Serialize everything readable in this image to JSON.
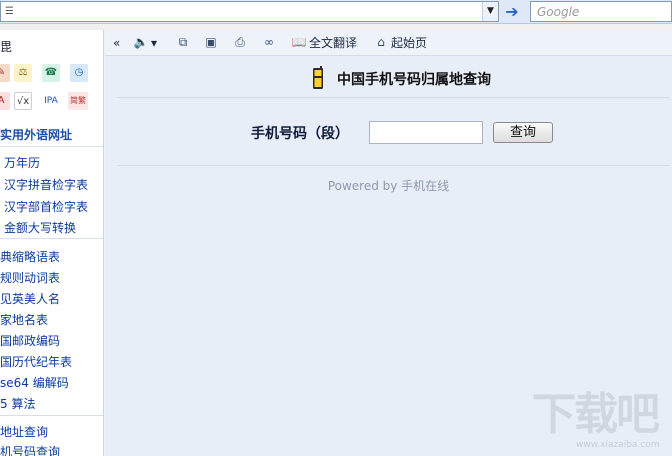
{
  "topbar": {
    "search_placeholder": "Google"
  },
  "sidebar": {
    "heading_fragment": "毘",
    "section_title": "实用外语网址",
    "links_group1": [
      "万年历",
      "汉字拼音检字表",
      "汉字部首检字表",
      "金额大写转换"
    ],
    "links_group2": [
      "典缩略语表",
      "规则动词表",
      "见英美人名",
      "家地名表",
      "国邮政编码",
      "国历代纪年表",
      "se64 编解码",
      "5 算法"
    ],
    "links_group3": [
      "地址查询",
      "机号码查询"
    ],
    "icon_labels": [
      "IPA",
      "简繁"
    ]
  },
  "toolbar": {
    "translate_label": "全文翻译",
    "home_label": "起始页"
  },
  "main": {
    "title": "中国手机号码归属地查询",
    "form_label": "手机号码（段）",
    "input_value": "",
    "query_button": "查询",
    "powered_by": "Powered by 手机在线"
  },
  "watermark": {
    "text": "下载吧",
    "url": "www.xiazaiba.com"
  }
}
